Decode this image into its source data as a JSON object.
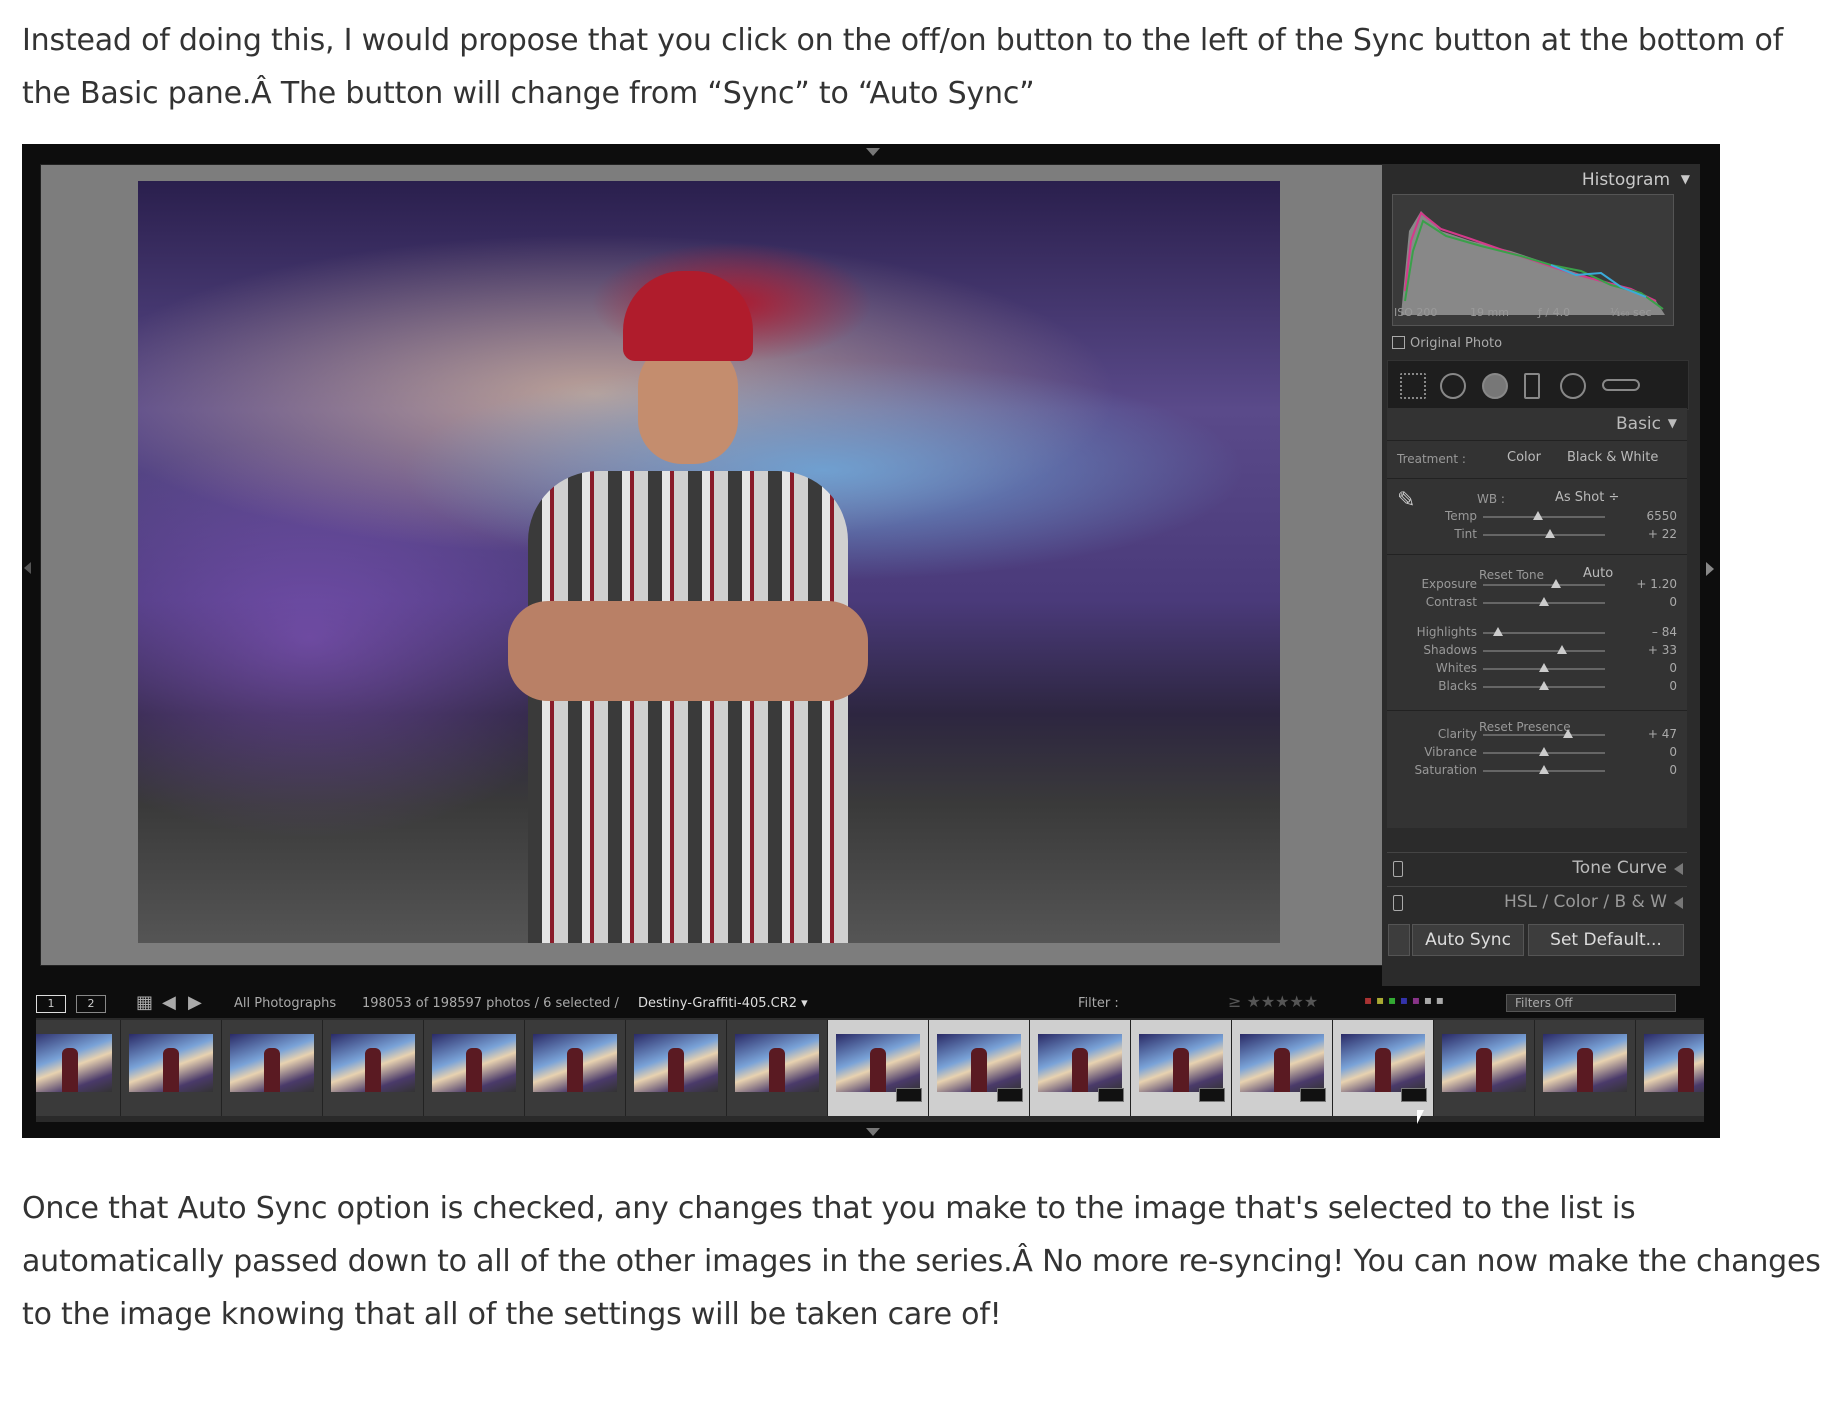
{
  "article": {
    "para1": "Instead of doing this, I would propose that you click on the off/on button to the left of the Sync button at the bottom of the Basic pane.Â  The button will change from “Sync” to “Auto Sync”",
    "para2": "Once that Auto Sync option is checked, any changes that you make to the image that's selected to the list is automatically passed down to all of the other images in the series.Â  No more re-syncing! You can now make the changes to the image knowing that all of the settings will be taken care of!"
  },
  "panel": {
    "histogram_title": "Histogram",
    "exif": [
      "ISO 200",
      "19 mm",
      "ƒ / 4.0",
      "¹⁄₁₆₀ sec"
    ],
    "original_photo": "Original Photo",
    "basic_title": "Basic",
    "treatment_label": "Treatment :",
    "treatment_color": "Color",
    "treatment_bw": "Black & White",
    "wb_label": "WB :",
    "wb_value": "As Shot ÷",
    "reset_tone": "Reset Tone",
    "auto": "Auto",
    "reset_presence": "Reset Presence",
    "sliders": [
      {
        "label": "Temp",
        "value": "6550",
        "pos": 0.45
      },
      {
        "label": "Tint",
        "value": "+ 22",
        "pos": 0.55
      },
      {
        "label": "Exposure",
        "value": "+ 1.20",
        "pos": 0.6
      },
      {
        "label": "Contrast",
        "value": "0",
        "pos": 0.5
      },
      {
        "label": "Highlights",
        "value": "– 84",
        "pos": 0.12
      },
      {
        "label": "Shadows",
        "value": "+ 33",
        "pos": 0.65
      },
      {
        "label": "Whites",
        "value": "0",
        "pos": 0.5
      },
      {
        "label": "Blacks",
        "value": "0",
        "pos": 0.5
      },
      {
        "label": "Clarity",
        "value": "+ 47",
        "pos": 0.7
      },
      {
        "label": "Vibrance",
        "value": "0",
        "pos": 0.5
      },
      {
        "label": "Saturation",
        "value": "0",
        "pos": 0.5
      }
    ],
    "tone_curve": "Tone Curve",
    "hsl": "HSL  /  Color  /  B & W",
    "auto_sync": "Auto Sync",
    "set_default": "Set Default..."
  },
  "filmstrip": {
    "page1": "1",
    "page2": "2",
    "source": "All Photographs",
    "count": "198053 of 198597 photos / 6 selected /",
    "filename": "Destiny-Graffiti-405.CR2 ▾",
    "filter_label": "Filter :",
    "filters_off": "Filters Off"
  },
  "colors": {
    "panel_bg": "#2b2b2b",
    "selected_thumb": "#cfcfcf",
    "text": "#333333"
  }
}
